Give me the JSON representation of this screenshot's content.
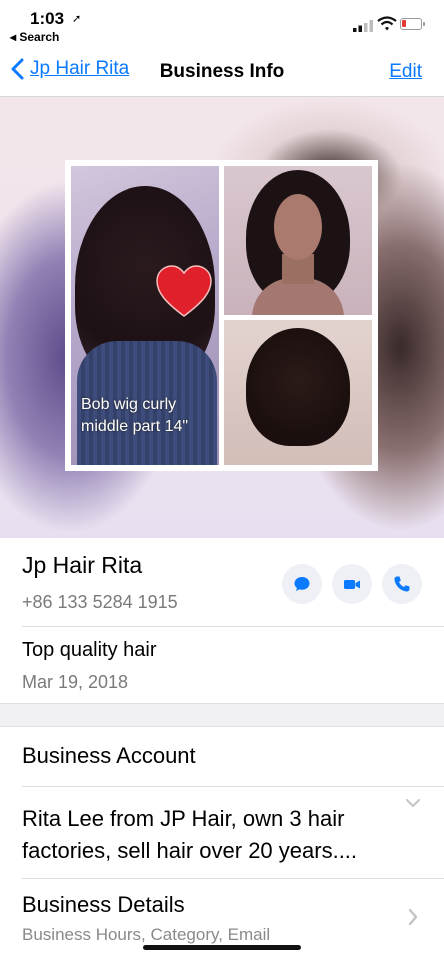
{
  "status_bar": {
    "time": "1:03",
    "back_label": "◂ Search"
  },
  "nav": {
    "back_label": "Jp Hair Rita",
    "title": "Business Info",
    "edit_label": "Edit"
  },
  "cover": {
    "caption": "Bob wig curly middle part 14\""
  },
  "contact": {
    "name": "Jp Hair Rita",
    "phone": "+86 133 5284 1915",
    "actions": [
      "message-icon",
      "video-icon",
      "phone-icon"
    ],
    "accent": "#0a7aff"
  },
  "about": {
    "text": "Top quality hair",
    "date": "Mar 19, 2018"
  },
  "business": {
    "account_label": "Business Account",
    "description": "Rita Lee from JP Hair, own 3 hair factories, sell hair over 20 years....",
    "details_label": "Business Details",
    "details_sub": "Business Hours, Category, Email"
  }
}
